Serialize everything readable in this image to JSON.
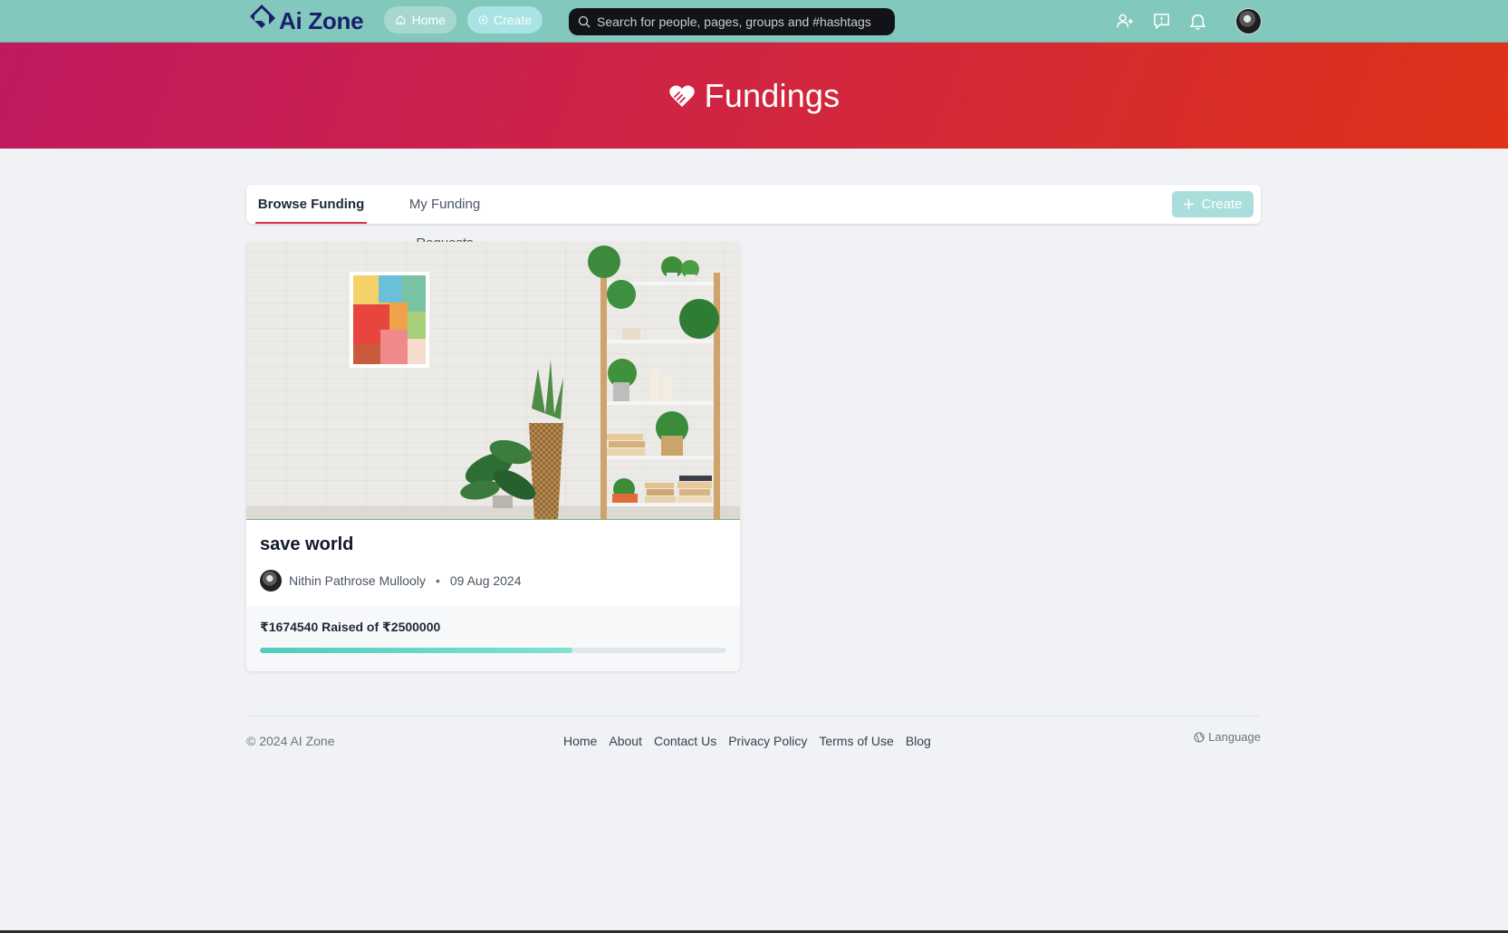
{
  "nav": {
    "logo_text": "Ai Zone",
    "home_label": "Home",
    "create_label": "Create",
    "search_placeholder": "Search for people, pages, groups and #hashtags",
    "icons": [
      "add-friend-icon",
      "chat-icon",
      "bell-icon"
    ]
  },
  "banner": {
    "title": "Fundings",
    "icon": "heart-handshake-icon"
  },
  "tabs": {
    "items": [
      {
        "label": "Browse Funding",
        "active": true
      },
      {
        "label": "My Funding Requests",
        "active": false
      }
    ],
    "create_label": "Create"
  },
  "fundings": [
    {
      "title": "save world",
      "author": "Nithin Pathrose Mullooly",
      "date": "09 Aug 2024",
      "raised_text": "₹1674540 Raised of ₹2500000",
      "raised": 1674540,
      "goal": 2500000
    }
  ],
  "footer": {
    "copyright": "© 2024 AI Zone",
    "links": [
      "Home",
      "About",
      "Contact Us",
      "Privacy Policy",
      "Terms of Use",
      "Blog"
    ],
    "language_label": "Language"
  },
  "colors": {
    "navbar": "#82c8bd",
    "banner_start": "#bf1a60",
    "banner_end": "#df3218",
    "accent_tab": "#d9334a",
    "progress": "#4fcdbd"
  }
}
